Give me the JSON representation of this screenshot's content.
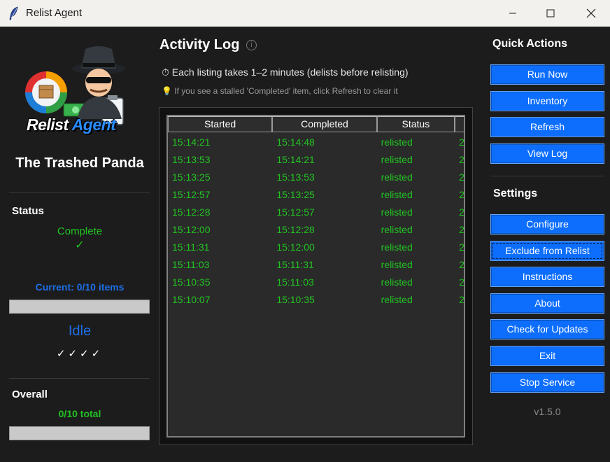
{
  "window": {
    "title": "Relist Agent"
  },
  "logo": {
    "word1": "Relist",
    "word2": "Agent"
  },
  "store_name": "The Trashed Panda",
  "status": {
    "label": "Status",
    "value": "Complete",
    "check": "✓",
    "current": "Current: 0/10 items",
    "current_progress": 0,
    "state": "Idle",
    "ticks": "✓✓✓✓"
  },
  "overall": {
    "label": "Overall",
    "value": "0/10 total",
    "progress": 0
  },
  "activity": {
    "title": "Activity Log",
    "note1": "⏱ Each listing takes 1–2 minutes (delists before relisting)",
    "note2": "💡 If you see a stalled 'Completed' item, click Refresh to clear it",
    "columns": [
      "Started",
      "Completed",
      "Status",
      ""
    ],
    "rows": [
      [
        "15:14:21",
        "15:14:48",
        "relisted",
        "2"
      ],
      [
        "15:13:53",
        "15:14:21",
        "relisted",
        "2"
      ],
      [
        "15:13:25",
        "15:13:53",
        "relisted",
        "2"
      ],
      [
        "15:12:57",
        "15:13:25",
        "relisted",
        "2"
      ],
      [
        "15:12:28",
        "15:12:57",
        "relisted",
        "2"
      ],
      [
        "15:12:00",
        "15:12:28",
        "relisted",
        "2"
      ],
      [
        "15:11:31",
        "15:12:00",
        "relisted",
        "2"
      ],
      [
        "15:11:03",
        "15:11:31",
        "relisted",
        "2"
      ],
      [
        "15:10:35",
        "15:11:03",
        "relisted",
        "2"
      ],
      [
        "15:10:07",
        "15:10:35",
        "relisted",
        "2"
      ]
    ]
  },
  "quick_actions": {
    "title": "Quick Actions",
    "buttons": [
      "Run Now",
      "Inventory",
      "Refresh",
      "View Log"
    ]
  },
  "settings": {
    "title": "Settings",
    "buttons": [
      "Configure",
      "Exclude from Relist",
      "Instructions",
      "About",
      "Check for Updates",
      "Exit",
      "Stop Service"
    ]
  },
  "version": "v1.5.0",
  "colors": {
    "accent": "#0d6efd",
    "success": "#22c322",
    "current": "#1e6fe6",
    "background": "#1c1c1c"
  }
}
